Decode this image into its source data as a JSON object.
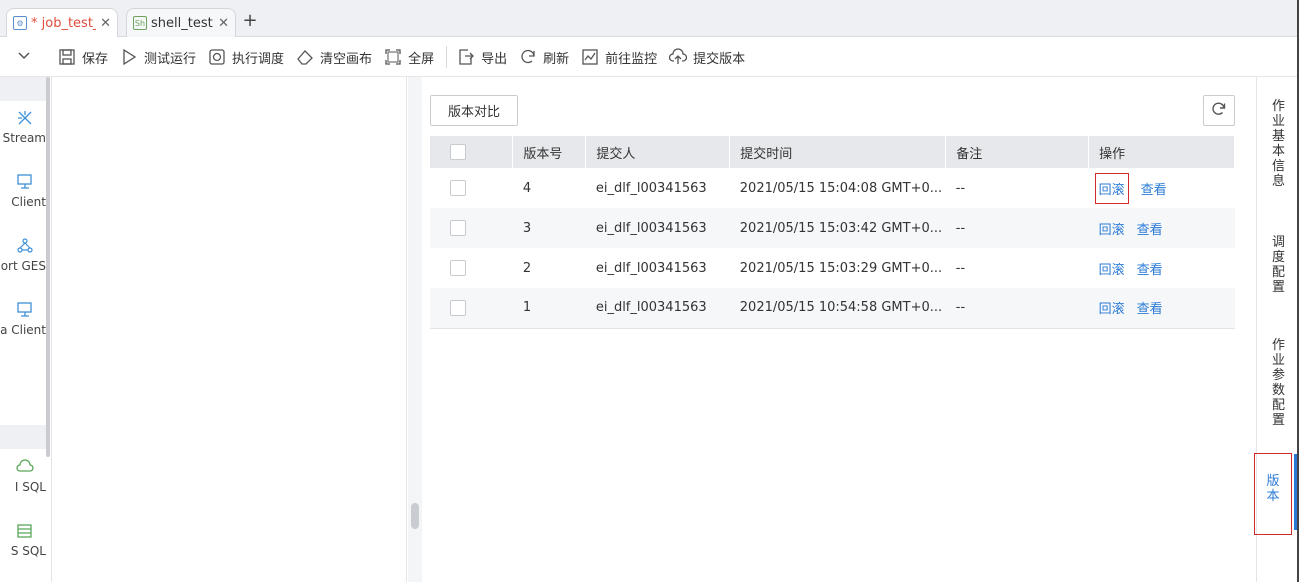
{
  "tabs": [
    {
      "label": "* job_test_...",
      "modified": true
    },
    {
      "label": "shell_test",
      "modified": false
    }
  ],
  "toolbar": {
    "items": [
      {
        "label": "保存",
        "icon": "save-icon"
      },
      {
        "label": "测试运行",
        "icon": "play-icon"
      },
      {
        "label": "执行调度",
        "icon": "schedule-icon"
      },
      {
        "label": "清空画布",
        "icon": "eraser-icon"
      },
      {
        "label": "全屏",
        "icon": "fullscreen-icon"
      },
      {
        "label": "导出",
        "icon": "export-icon"
      },
      {
        "label": "刷新",
        "icon": "refresh-icon"
      },
      {
        "label": "前往监控",
        "icon": "monitor-icon"
      },
      {
        "label": "提交版本",
        "icon": "upload-icon"
      }
    ]
  },
  "palette": {
    "items": [
      {
        "label": "Stream",
        "icon": "stream-icon"
      },
      {
        "label": "Client",
        "icon": "client-icon"
      },
      {
        "label": "ort GES",
        "icon": "ges-icon"
      },
      {
        "label": "a Client",
        "icon": "client-icon"
      },
      {
        "label": "I SQL",
        "icon": "sql-icon"
      },
      {
        "label": "S SQL",
        "icon": "database-icon"
      }
    ]
  },
  "versions": {
    "compare_label": "版本对比",
    "columns": [
      "版本号",
      "提交人",
      "提交时间",
      "备注",
      "操作"
    ],
    "rows": [
      {
        "version": "4",
        "submitter": "ei_dlf_l00341563",
        "time": "2021/05/15 15:04:08 GMT+0...",
        "note": "--"
      },
      {
        "version": "3",
        "submitter": "ei_dlf_l00341563",
        "time": "2021/05/15 15:03:42 GMT+0...",
        "note": "--"
      },
      {
        "version": "2",
        "submitter": "ei_dlf_l00341563",
        "time": "2021/05/15 15:03:29 GMT+0...",
        "note": "--"
      },
      {
        "version": "1",
        "submitter": "ei_dlf_l00341563",
        "time": "2021/05/15 10:54:58 GMT+0...",
        "note": "--"
      }
    ],
    "rollback_label": "回滚",
    "view_label": "查看"
  },
  "right_tabs": [
    {
      "label": "作业基本信息",
      "active": false
    },
    {
      "label": "调度配置",
      "active": false
    },
    {
      "label": "作业参数配置",
      "active": false
    },
    {
      "label": "版本",
      "active": true
    }
  ],
  "colors": {
    "accent": "#2b7bd6",
    "highlight": "#d02a2a",
    "tab_modified": "#e14c3b"
  }
}
